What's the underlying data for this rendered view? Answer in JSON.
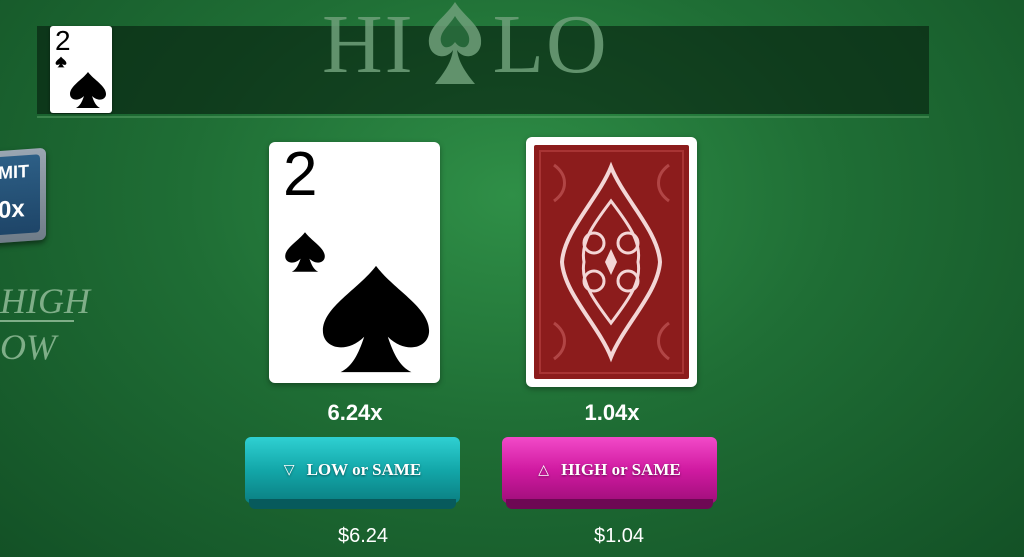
{
  "title": {
    "left": "HI",
    "right": "LO"
  },
  "history": {
    "cards": [
      {
        "rank": "2",
        "suit": "spade"
      }
    ]
  },
  "limit": {
    "label": "MIT",
    "value": "0x"
  },
  "side": {
    "high": "HIGH",
    "low": "OW"
  },
  "current_card": {
    "rank": "2",
    "suit": "spade"
  },
  "next_card": {
    "state": "face-down"
  },
  "multipliers": {
    "low": "6.24x",
    "high": "1.04x"
  },
  "buttons": {
    "low": {
      "label": "LOW or SAME",
      "icon": "triangle-down-icon"
    },
    "high": {
      "label": "HIGH or SAME",
      "icon": "triangle-up-icon"
    }
  },
  "payouts": {
    "low": "$6.24",
    "high": "$1.04"
  },
  "colors": {
    "table": "#1f6e35",
    "low_button": "#13a7a9",
    "high_button": "#d01aa1",
    "card_back": "#8c1c1c"
  }
}
